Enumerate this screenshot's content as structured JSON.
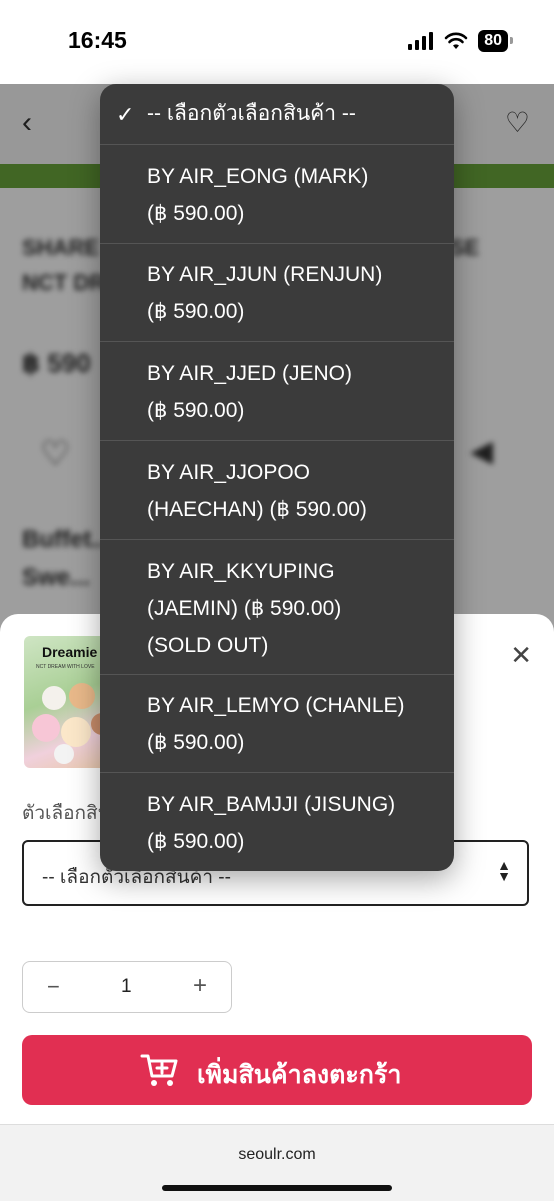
{
  "status_bar": {
    "time": "16:45",
    "battery": "80"
  },
  "background_page": {
    "line1": "SHARE ตุ๊กตา NCT DREAM HELP... CHOOSE",
    "line2": "NCT DREAM...",
    "price": "฿ 590",
    "desc1": "Buffet...",
    "desc2": "Swe..."
  },
  "sheet": {
    "thumb_title": "Dreamie",
    "thumb_subtitle": "NCT DREAM WITH LOVE",
    "option_label": "ตัวเลือกสินค้า",
    "select_value": "-- เลือกตัวเลือกสินค้า --",
    "quantity": "1",
    "minus": "−",
    "plus": "+",
    "add_to_cart": "เพิ่มสินค้าลงตะกร้า"
  },
  "url": "seoulr.com",
  "dropdown": {
    "items": [
      {
        "line1": "-- เลือกตัวเลือกสินค้า --",
        "line2": "",
        "line3": "",
        "selected": true
      },
      {
        "line1": "BY AIR_EONG (MARK)",
        "line2": "(฿ 590.00)",
        "line3": "",
        "selected": false
      },
      {
        "line1": "BY AIR_JJUN (RENJUN)",
        "line2": "(฿ 590.00)",
        "line3": "",
        "selected": false
      },
      {
        "line1": "BY AIR_JJED (JENO)",
        "line2": "(฿ 590.00)",
        "line3": "",
        "selected": false
      },
      {
        "line1": "BY AIR_JJOPOO",
        "line2": "(HAECHAN) (฿ 590.00)",
        "line3": "",
        "selected": false
      },
      {
        "line1": "BY AIR_KKYUPING",
        "line2": "(JAEMIN) (฿ 590.00)",
        "line3": "(SOLD OUT)",
        "selected": false
      },
      {
        "line1": "BY AIR_LEMYO (CHANLE)",
        "line2": "(฿ 590.00)",
        "line3": "",
        "selected": false
      },
      {
        "line1": "BY AIR_BAMJJI (JISUNG)",
        "line2": "(฿ 590.00)",
        "line3": "",
        "selected": false
      }
    ]
  },
  "colors": {
    "accent": "#e12f52",
    "dropdown_bg": "#3b3b3b",
    "green_bar": "#6aa53a"
  },
  "icons": {
    "check": "checkmark-icon",
    "close": "close-icon",
    "cart": "cart-add-icon",
    "back": "chevron-left-icon",
    "wishlist": "heart-icon"
  }
}
